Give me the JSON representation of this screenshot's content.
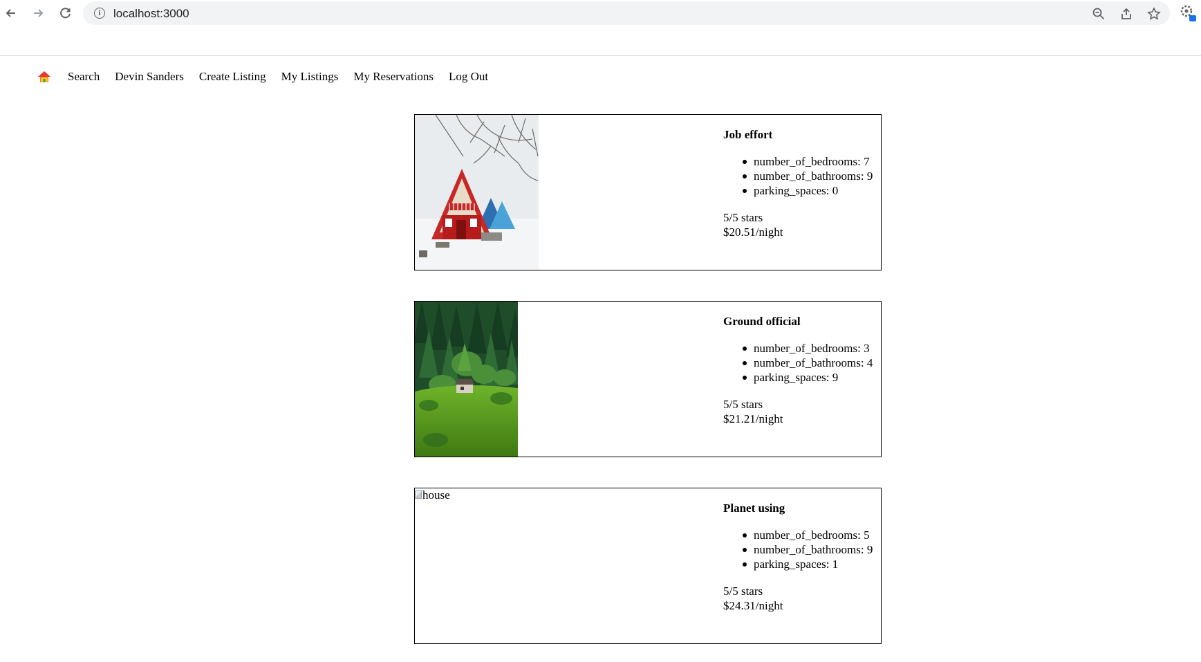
{
  "browser": {
    "url": "localhost:3000",
    "back_icon": "arrow-left-icon",
    "forward_icon": "arrow-right-icon",
    "reload_icon": "reload-icon",
    "info_icon": "info-icon",
    "zoom_icon": "zoom-out-icon",
    "share_icon": "share-icon",
    "bookmark_icon": "star-icon",
    "extension_icon": "extension-icon"
  },
  "nav": {
    "home_icon": "house-icon",
    "links": [
      "Search",
      "Devin Sanders",
      "Create Listing",
      "My Listings",
      "My Reservations",
      "Log Out"
    ]
  },
  "listings": [
    {
      "title": "Job effort",
      "image": "a-frame-cabin-snow",
      "features": [
        "number_of_bedrooms: 7",
        "number_of_bathrooms: 9",
        "parking_spaces: 0"
      ],
      "rating": "5/5 stars",
      "price": "$20.51/night"
    },
    {
      "title": "Ground official",
      "image": "house-in-green-forest",
      "features": [
        "number_of_bedrooms: 3",
        "number_of_bathrooms: 4",
        "parking_spaces: 9"
      ],
      "rating": "5/5 stars",
      "price": "$21.21/night"
    },
    {
      "title": "Planet using",
      "image_alt": "house",
      "features": [
        "number_of_bedrooms: 5",
        "number_of_bathrooms: 9",
        "parking_spaces: 1"
      ],
      "rating": "5/5 stars",
      "price": "$24.31/night"
    }
  ],
  "colors": {
    "chrome_icon": "#5f6368",
    "omnibox_bg": "#f1f3f4",
    "extension_accent": "#1a73e8",
    "cabin_red": "#c62828",
    "forest_green": "#4a8a1e"
  }
}
